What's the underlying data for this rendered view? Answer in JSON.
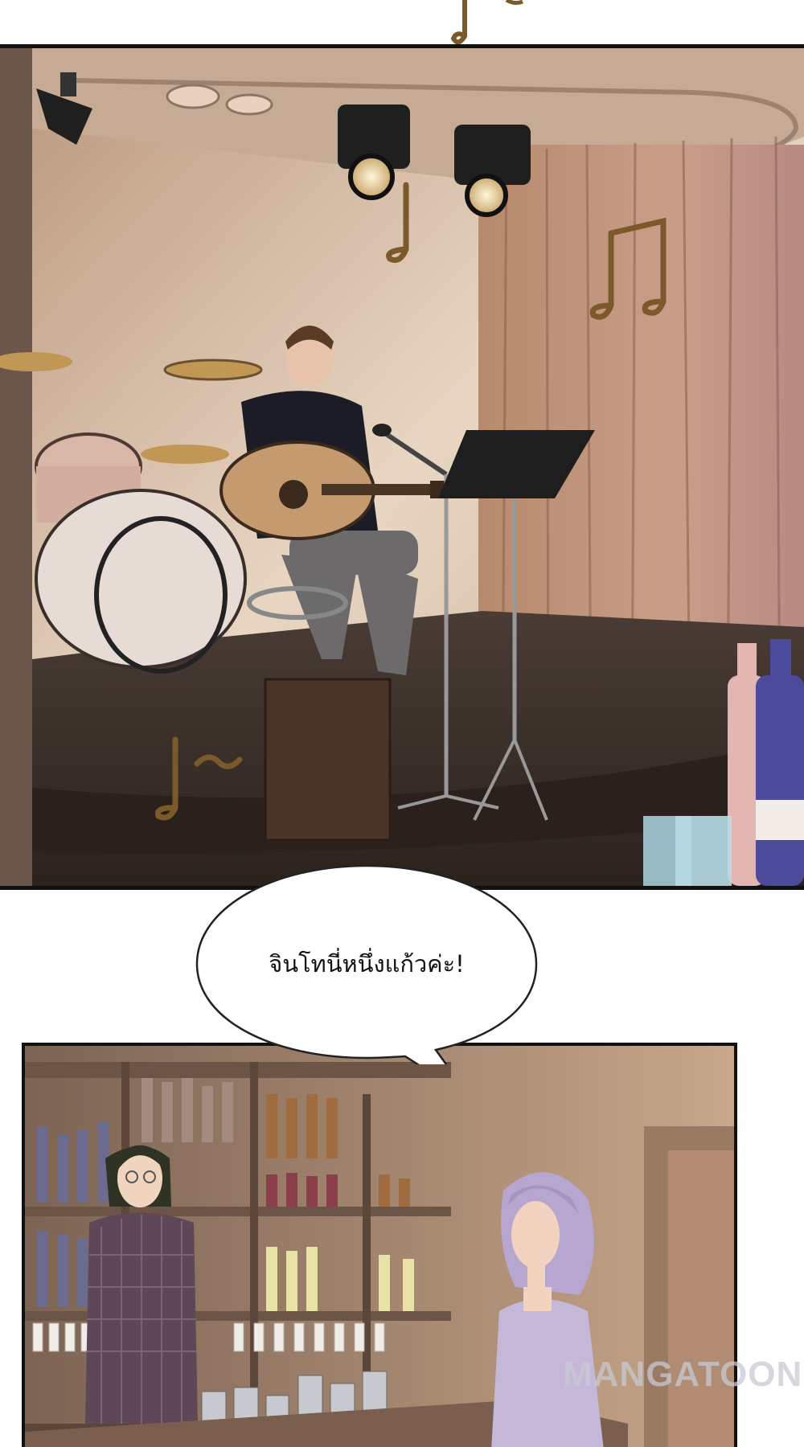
{
  "speech_bubble": {
    "text": "จินโทนี่หนึ่งแก้วค่ะ!"
  },
  "watermark": {
    "text": "MANGATOON"
  },
  "colors": {
    "stage_wall": "#c9a98a",
    "curtain": "#a87a5e",
    "stage_floor": "#3b2f2a",
    "bar_wood": "#8a6a55",
    "music_note": "#7a5a2a",
    "border": "#111111"
  },
  "icons": [
    "music-note-icon",
    "spotlight-icon",
    "guitar-icon",
    "microphone-icon"
  ]
}
